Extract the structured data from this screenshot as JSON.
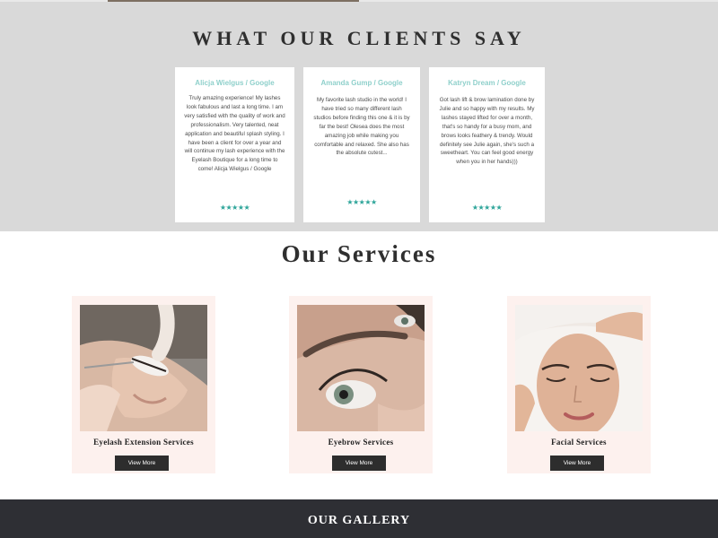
{
  "testimonials": {
    "title": "WHAT OUR CLIENTS SAY",
    "reviews": [
      {
        "author": "Alicja Wielgus / Google",
        "text": "Truly amazing experience! My lashes look fabulous and last a long time. I am very satisfied with the quality of work and professionalism. Very talented, neat application and beautiful splash styling. I have been a client for over a year and will continue my lash experience with the Eyelash Boutique for a long time to come! Alicja Wielgus / Google",
        "stars": "★★★★★",
        "rating": 5
      },
      {
        "author": "Amanda Gump / Google",
        "text": "My favorite lash studio in the world! I have tried so many different lash studios before finding this one & it is by far the best! Olesea does the most amazing job while making you comfortable and relaxed. She also has the absolute cutest...",
        "stars": "★★★★★",
        "rating": 5
      },
      {
        "author": "Katryn Dream / Google",
        "text": "Got lash lift & brow lamination done by Julie and so happy with my results. My lashes stayed lifted for over a month, that's so handy for a busy mom, and brows looks feathery & trendy. Would definitely see Julie again, she's such a sweetheart. You can feel good energy when you in her hands)))",
        "stars": "★★★★★",
        "rating": 5
      }
    ]
  },
  "services": {
    "title": "Our Services",
    "items": [
      {
        "name": "Eyelash Extension Services",
        "button_label": "View More"
      },
      {
        "name": "Eyebrow Services",
        "button_label": "View More"
      },
      {
        "name": "Facial Services",
        "button_label": "View More"
      }
    ]
  },
  "gallery": {
    "title": "OUR GALLERY"
  },
  "colors": {
    "testimonial_background": "#d9d9d9",
    "author_accent": "#8fd0cb",
    "star_color": "#2ea59a",
    "service_card_background": "#fdf1ee",
    "button_background": "#2d2d2d",
    "footer_background": "#2e2f34"
  }
}
